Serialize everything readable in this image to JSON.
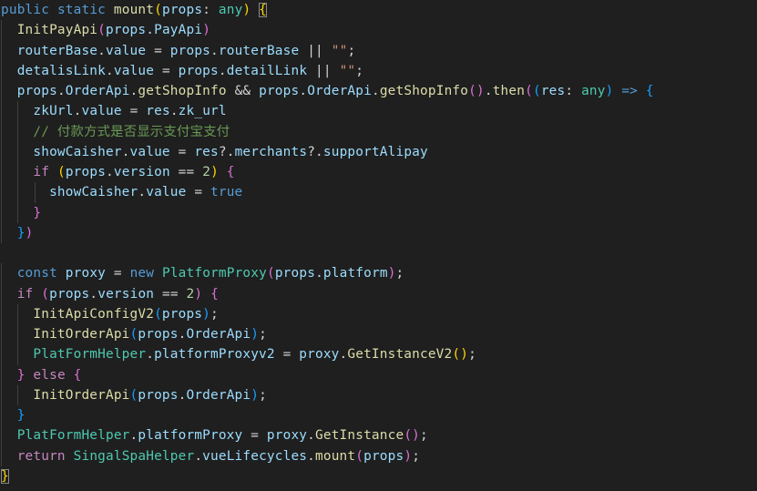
{
  "editor": {
    "language": "typescript",
    "lines": [
      {
        "indent": 0,
        "tokens": [
          {
            "t": "public",
            "c": "kw"
          },
          {
            "t": " ",
            "c": "op"
          },
          {
            "t": "static",
            "c": "kw"
          },
          {
            "t": " ",
            "c": "op"
          },
          {
            "t": "mount",
            "c": "fn"
          },
          {
            "t": "(",
            "c": "b1"
          },
          {
            "t": "props",
            "c": "var"
          },
          {
            "t": ": ",
            "c": "op"
          },
          {
            "t": "any",
            "c": "type"
          },
          {
            "t": ")",
            "c": "b1"
          },
          {
            "t": " ",
            "c": "op"
          },
          {
            "t": "{",
            "c": "bmatch"
          }
        ]
      },
      {
        "indent": 1,
        "tokens": [
          {
            "t": "InitPayApi",
            "c": "fn"
          },
          {
            "t": "(",
            "c": "b2"
          },
          {
            "t": "props",
            "c": "var"
          },
          {
            "t": ".",
            "c": "op"
          },
          {
            "t": "PayApi",
            "c": "prop"
          },
          {
            "t": ")",
            "c": "b2"
          }
        ]
      },
      {
        "indent": 1,
        "tokens": [
          {
            "t": "routerBase",
            "c": "var"
          },
          {
            "t": ".",
            "c": "op"
          },
          {
            "t": "value",
            "c": "prop"
          },
          {
            "t": " = ",
            "c": "op"
          },
          {
            "t": "props",
            "c": "var"
          },
          {
            "t": ".",
            "c": "op"
          },
          {
            "t": "routerBase",
            "c": "prop"
          },
          {
            "t": " || ",
            "c": "op"
          },
          {
            "t": "\"\"",
            "c": "str"
          },
          {
            "t": ";",
            "c": "op"
          }
        ]
      },
      {
        "indent": 1,
        "tokens": [
          {
            "t": "detalisLink",
            "c": "var"
          },
          {
            "t": ".",
            "c": "op"
          },
          {
            "t": "value",
            "c": "prop"
          },
          {
            "t": " = ",
            "c": "op"
          },
          {
            "t": "props",
            "c": "var"
          },
          {
            "t": ".",
            "c": "op"
          },
          {
            "t": "detailLink",
            "c": "prop"
          },
          {
            "t": " || ",
            "c": "op"
          },
          {
            "t": "\"\"",
            "c": "str"
          },
          {
            "t": ";",
            "c": "op"
          }
        ]
      },
      {
        "indent": 1,
        "tokens": [
          {
            "t": "props",
            "c": "var"
          },
          {
            "t": ".",
            "c": "op"
          },
          {
            "t": "OrderApi",
            "c": "prop"
          },
          {
            "t": ".",
            "c": "op"
          },
          {
            "t": "getShopInfo",
            "c": "fn"
          },
          {
            "t": " && ",
            "c": "op"
          },
          {
            "t": "props",
            "c": "var"
          },
          {
            "t": ".",
            "c": "op"
          },
          {
            "t": "OrderApi",
            "c": "prop"
          },
          {
            "t": ".",
            "c": "op"
          },
          {
            "t": "getShopInfo",
            "c": "fn"
          },
          {
            "t": "(",
            "c": "b2"
          },
          {
            "t": ")",
            "c": "b2"
          },
          {
            "t": ".",
            "c": "op"
          },
          {
            "t": "then",
            "c": "fn"
          },
          {
            "t": "(",
            "c": "b2"
          },
          {
            "t": "(",
            "c": "b3"
          },
          {
            "t": "res",
            "c": "var"
          },
          {
            "t": ": ",
            "c": "op"
          },
          {
            "t": "any",
            "c": "type"
          },
          {
            "t": ")",
            "c": "b3"
          },
          {
            "t": " ",
            "c": "op"
          },
          {
            "t": "=>",
            "c": "kw"
          },
          {
            "t": " ",
            "c": "op"
          },
          {
            "t": "{",
            "c": "b3"
          }
        ]
      },
      {
        "indent": 2,
        "tokens": [
          {
            "t": "zkUrl",
            "c": "var"
          },
          {
            "t": ".",
            "c": "op"
          },
          {
            "t": "value",
            "c": "prop"
          },
          {
            "t": " = ",
            "c": "op"
          },
          {
            "t": "res",
            "c": "var"
          },
          {
            "t": ".",
            "c": "op"
          },
          {
            "t": "zk_url",
            "c": "prop"
          }
        ]
      },
      {
        "indent": 2,
        "tokens": [
          {
            "t": "// 付款方式是否显示支付宝支付",
            "c": "comment"
          }
        ]
      },
      {
        "indent": 2,
        "tokens": [
          {
            "t": "showCaisher",
            "c": "var"
          },
          {
            "t": ".",
            "c": "op"
          },
          {
            "t": "value",
            "c": "prop"
          },
          {
            "t": " = ",
            "c": "op"
          },
          {
            "t": "res",
            "c": "var"
          },
          {
            "t": "?.",
            "c": "op"
          },
          {
            "t": "merchants",
            "c": "prop"
          },
          {
            "t": "?.",
            "c": "op"
          },
          {
            "t": "supportAlipay",
            "c": "prop"
          }
        ]
      },
      {
        "indent": 2,
        "tokens": [
          {
            "t": "if",
            "c": "ctrl"
          },
          {
            "t": " ",
            "c": "op"
          },
          {
            "t": "(",
            "c": "b1"
          },
          {
            "t": "props",
            "c": "var"
          },
          {
            "t": ".",
            "c": "op"
          },
          {
            "t": "version",
            "c": "prop"
          },
          {
            "t": " == ",
            "c": "op"
          },
          {
            "t": "2",
            "c": "num"
          },
          {
            "t": ")",
            "c": "b1"
          },
          {
            "t": " ",
            "c": "op"
          },
          {
            "t": "{",
            "c": "b2"
          }
        ]
      },
      {
        "indent": 3,
        "tokens": [
          {
            "t": "showCaisher",
            "c": "var"
          },
          {
            "t": ".",
            "c": "op"
          },
          {
            "t": "value",
            "c": "prop"
          },
          {
            "t": " = ",
            "c": "op"
          },
          {
            "t": "true",
            "c": "bool"
          }
        ]
      },
      {
        "indent": 2,
        "tokens": [
          {
            "t": "}",
            "c": "b2"
          }
        ]
      },
      {
        "indent": 1,
        "tokens": [
          {
            "t": "}",
            "c": "b3"
          },
          {
            "t": ")",
            "c": "b2"
          }
        ]
      },
      {
        "indent": 0,
        "tokens": []
      },
      {
        "indent": 1,
        "tokens": [
          {
            "t": "const",
            "c": "kw"
          },
          {
            "t": " ",
            "c": "op"
          },
          {
            "t": "proxy",
            "c": "var"
          },
          {
            "t": " = ",
            "c": "op"
          },
          {
            "t": "new",
            "c": "kw"
          },
          {
            "t": " ",
            "c": "op"
          },
          {
            "t": "PlatformProxy",
            "c": "class"
          },
          {
            "t": "(",
            "c": "b2"
          },
          {
            "t": "props",
            "c": "var"
          },
          {
            "t": ".",
            "c": "op"
          },
          {
            "t": "platform",
            "c": "prop"
          },
          {
            "t": ")",
            "c": "b2"
          },
          {
            "t": ";",
            "c": "op"
          }
        ]
      },
      {
        "indent": 1,
        "tokens": [
          {
            "t": "if",
            "c": "ctrl"
          },
          {
            "t": " ",
            "c": "op"
          },
          {
            "t": "(",
            "c": "b2"
          },
          {
            "t": "props",
            "c": "var"
          },
          {
            "t": ".",
            "c": "op"
          },
          {
            "t": "version",
            "c": "prop"
          },
          {
            "t": " == ",
            "c": "op"
          },
          {
            "t": "2",
            "c": "num"
          },
          {
            "t": ")",
            "c": "b2"
          },
          {
            "t": " ",
            "c": "op"
          },
          {
            "t": "{",
            "c": "b2"
          }
        ]
      },
      {
        "indent": 2,
        "tokens": [
          {
            "t": "InitApiConfigV2",
            "c": "fn"
          },
          {
            "t": "(",
            "c": "b3"
          },
          {
            "t": "props",
            "c": "var"
          },
          {
            "t": ")",
            "c": "b3"
          },
          {
            "t": ";",
            "c": "op"
          }
        ]
      },
      {
        "indent": 2,
        "tokens": [
          {
            "t": "InitOrderApi",
            "c": "fn"
          },
          {
            "t": "(",
            "c": "b3"
          },
          {
            "t": "props",
            "c": "var"
          },
          {
            "t": ".",
            "c": "op"
          },
          {
            "t": "OrderApi",
            "c": "prop"
          },
          {
            "t": ")",
            "c": "b3"
          },
          {
            "t": ";",
            "c": "op"
          }
        ]
      },
      {
        "indent": 2,
        "tokens": [
          {
            "t": "PlatFormHelper",
            "c": "class"
          },
          {
            "t": ".",
            "c": "op"
          },
          {
            "t": "platformProxyv2",
            "c": "prop"
          },
          {
            "t": " = ",
            "c": "op"
          },
          {
            "t": "proxy",
            "c": "var"
          },
          {
            "t": ".",
            "c": "op"
          },
          {
            "t": "GetInstanceV2",
            "c": "fn"
          },
          {
            "t": "(",
            "c": "b1"
          },
          {
            "t": ")",
            "c": "b1"
          },
          {
            "t": ";",
            "c": "op"
          }
        ]
      },
      {
        "indent": 1,
        "tokens": [
          {
            "t": "}",
            "c": "b2"
          },
          {
            "t": " ",
            "c": "op"
          },
          {
            "t": "else",
            "c": "ctrl"
          },
          {
            "t": " ",
            "c": "op"
          },
          {
            "t": "{",
            "c": "b2"
          }
        ]
      },
      {
        "indent": 2,
        "tokens": [
          {
            "t": "InitOrderApi",
            "c": "fn"
          },
          {
            "t": "(",
            "c": "b3"
          },
          {
            "t": "props",
            "c": "var"
          },
          {
            "t": ".",
            "c": "op"
          },
          {
            "t": "OrderApi",
            "c": "prop"
          },
          {
            "t": ")",
            "c": "b3"
          },
          {
            "t": ";",
            "c": "op"
          }
        ]
      },
      {
        "indent": 1,
        "tokens": [
          {
            "t": "}",
            "c": "b3"
          }
        ]
      },
      {
        "indent": 1,
        "tokens": [
          {
            "t": "PlatFormHelper",
            "c": "class"
          },
          {
            "t": ".",
            "c": "op"
          },
          {
            "t": "platformProxy",
            "c": "prop"
          },
          {
            "t": " = ",
            "c": "op"
          },
          {
            "t": "proxy",
            "c": "var"
          },
          {
            "t": ".",
            "c": "op"
          },
          {
            "t": "GetInstance",
            "c": "fn"
          },
          {
            "t": "(",
            "c": "b2"
          },
          {
            "t": ")",
            "c": "b2"
          },
          {
            "t": ";",
            "c": "op"
          }
        ]
      },
      {
        "indent": 1,
        "tokens": [
          {
            "t": "return",
            "c": "ctrl"
          },
          {
            "t": " ",
            "c": "op"
          },
          {
            "t": "SingalSpaHelper",
            "c": "class"
          },
          {
            "t": ".",
            "c": "op"
          },
          {
            "t": "vueLifecycles",
            "c": "prop"
          },
          {
            "t": ".",
            "c": "op"
          },
          {
            "t": "mount",
            "c": "fn"
          },
          {
            "t": "(",
            "c": "b2"
          },
          {
            "t": "props",
            "c": "var"
          },
          {
            "t": ")",
            "c": "b2"
          },
          {
            "t": ";",
            "c": "op"
          }
        ]
      },
      {
        "indent": 0,
        "tokens": [
          {
            "t": "}",
            "c": "bmatch"
          }
        ]
      }
    ]
  }
}
